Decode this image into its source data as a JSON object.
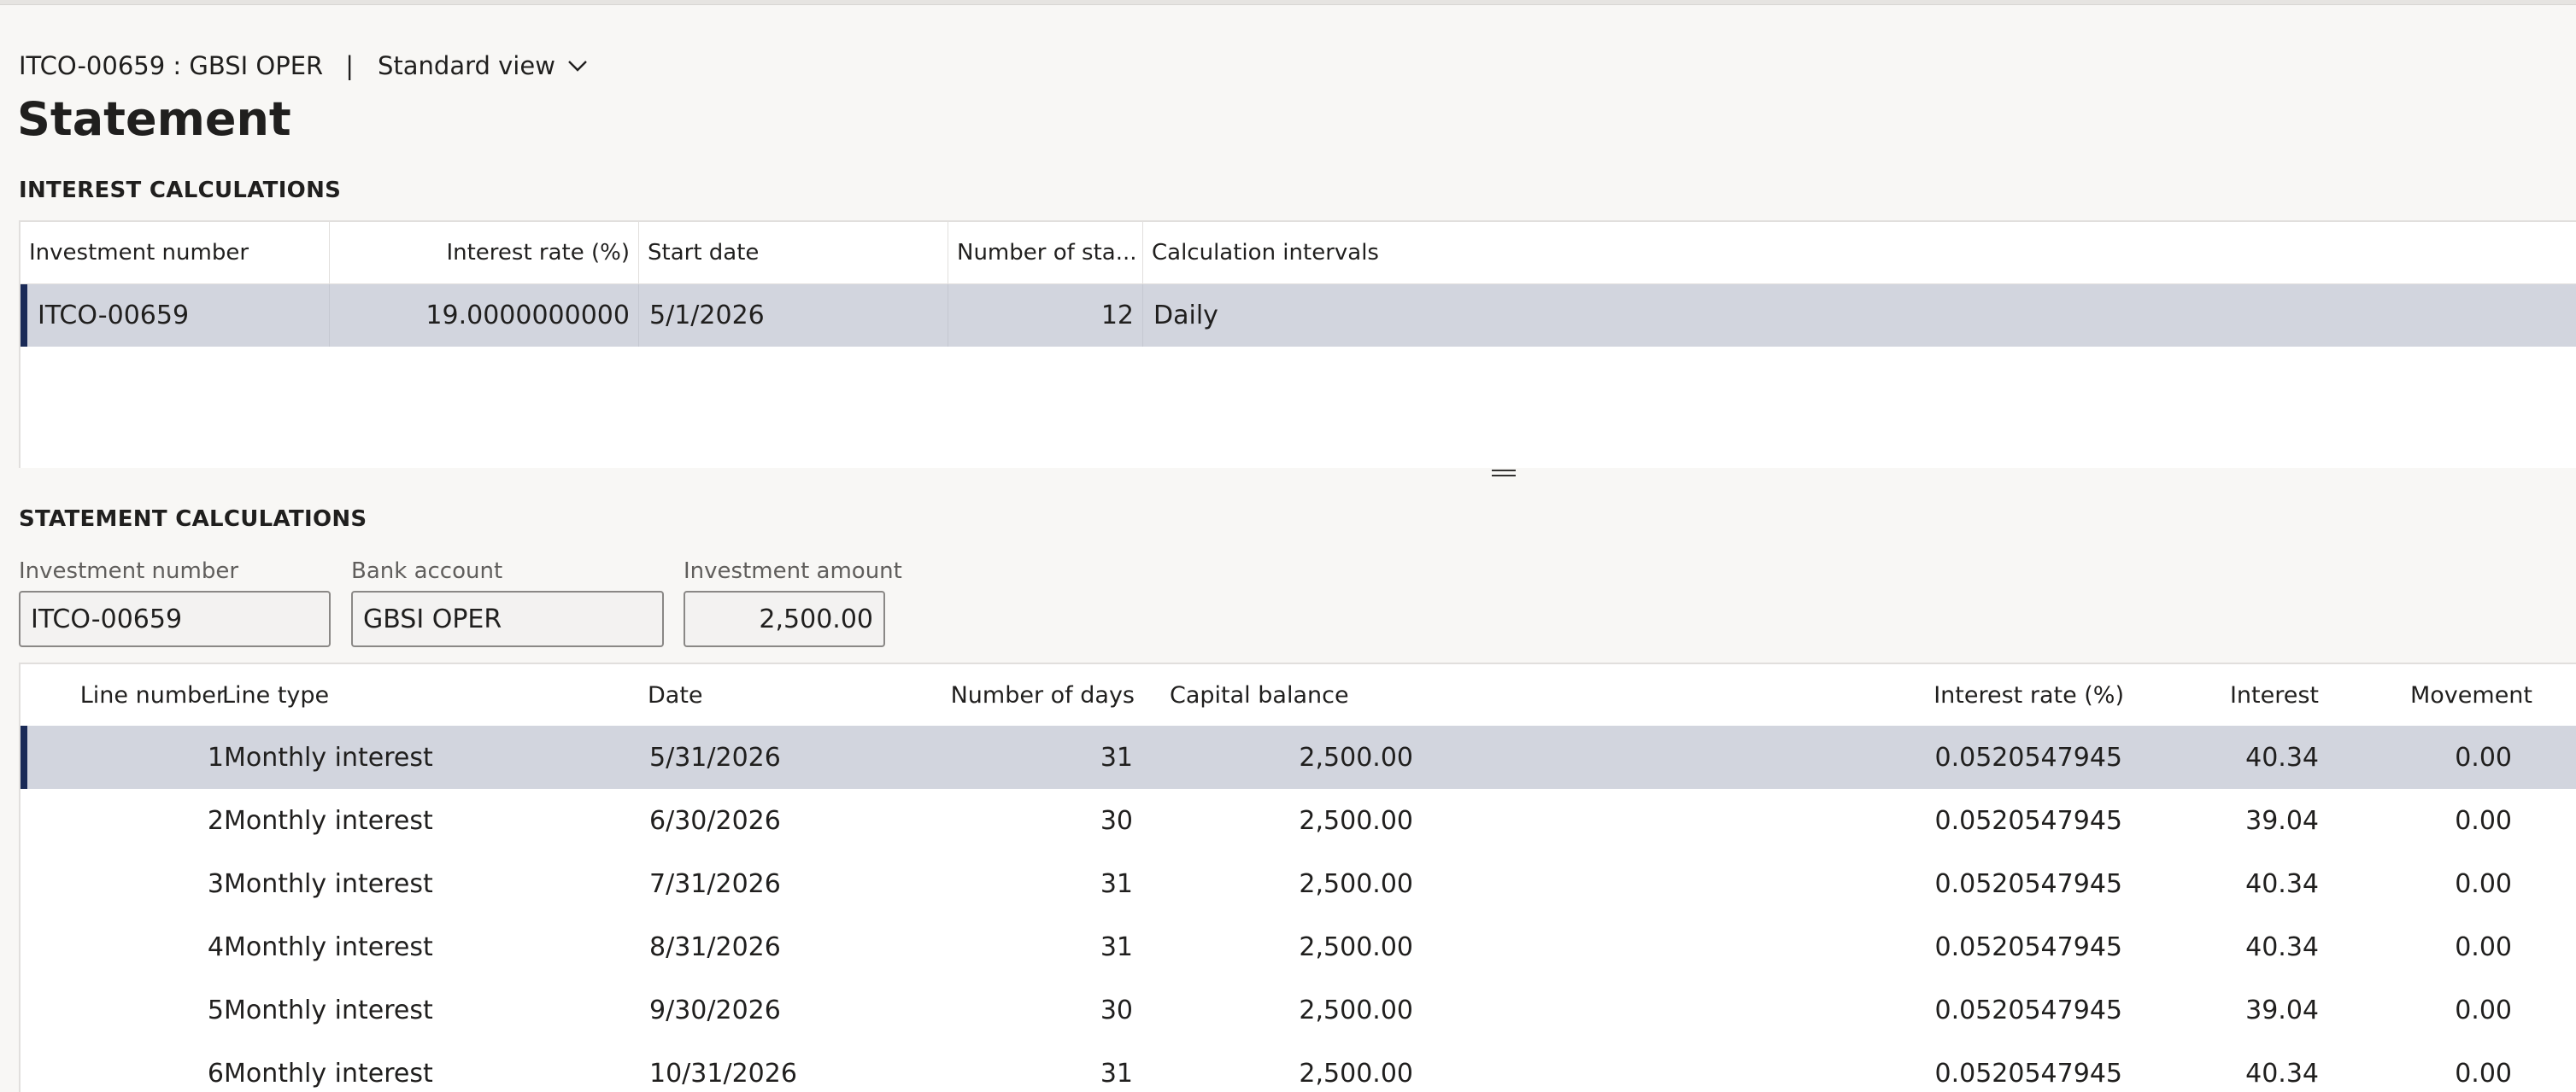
{
  "header": {
    "record": "ITCO-00659 : GBSI OPER",
    "separator": "|",
    "view": "Standard view"
  },
  "page_title": "Statement",
  "interest_section": {
    "title": "INTEREST CALCULATIONS",
    "columns": [
      "Investment number",
      "Interest rate (%)",
      "Start date",
      "Number of sta...",
      "Calculation intervals"
    ],
    "rows": [
      [
        "ITCO-00659",
        "19.0000000000",
        "5/1/2026",
        "12",
        "Daily"
      ]
    ]
  },
  "statement_section": {
    "title": "STATEMENT CALCULATIONS",
    "fields": {
      "investment_number": {
        "label": "Investment number",
        "value": "ITCO-00659"
      },
      "bank_account": {
        "label": "Bank account",
        "value": "GBSI OPER"
      },
      "investment_amount": {
        "label": "Investment amount",
        "value": "2,500.00"
      }
    },
    "columns": [
      "Line number",
      "Line type",
      "Date",
      "Number of days",
      "Capital balance",
      "Interest rate (%)",
      "Interest",
      "Movement"
    ],
    "rows": [
      [
        "1",
        "Monthly interest",
        "5/31/2026",
        "31",
        "2,500.00",
        "0.0520547945",
        "40.34",
        "0.00"
      ],
      [
        "2",
        "Monthly interest",
        "6/30/2026",
        "30",
        "2,500.00",
        "0.0520547945",
        "39.04",
        "0.00"
      ],
      [
        "3",
        "Monthly interest",
        "7/31/2026",
        "31",
        "2,500.00",
        "0.0520547945",
        "40.34",
        "0.00"
      ],
      [
        "4",
        "Monthly interest",
        "8/31/2026",
        "31",
        "2,500.00",
        "0.0520547945",
        "40.34",
        "0.00"
      ],
      [
        "5",
        "Monthly interest",
        "9/30/2026",
        "30",
        "2,500.00",
        "0.0520547945",
        "39.04",
        "0.00"
      ],
      [
        "6",
        "Monthly interest",
        "10/31/2026",
        "31",
        "2,500.00",
        "0.0520547945",
        "40.34",
        "0.00"
      ]
    ]
  },
  "colors": {
    "selected_row": "#d2d5de",
    "selection_bar": "#1a2a57",
    "page_background": "#f8f7f5"
  },
  "icons": {
    "view_dropdown": "chevron-down-icon",
    "splitter": "drag-handle-icon"
  }
}
